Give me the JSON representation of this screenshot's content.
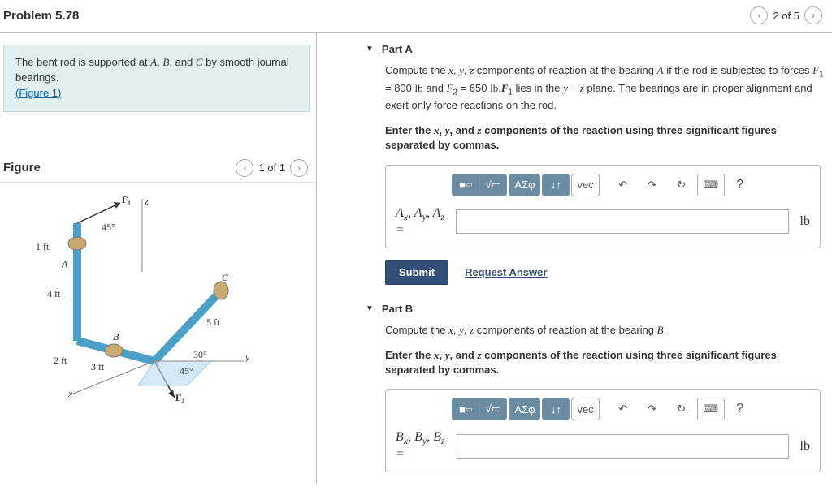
{
  "header": {
    "title": "Problem 5.78",
    "pager": "2 of 5"
  },
  "problem": {
    "line1_pre": "The bent rod is supported at ",
    "A": "A",
    "B": "B",
    "C": "C",
    "line1_mid1": ", ",
    "line1_mid2": ", and ",
    "line1_post": " by smooth journal bearings.",
    "fig_link": "(Figure 1)"
  },
  "figure": {
    "heading": "Figure",
    "pager": "1 of 1",
    "labels": {
      "F1": "F₁",
      "F2": "F₂",
      "A": "A",
      "B": "B",
      "C": "C",
      "z": "z",
      "y": "y",
      "x": "x",
      "ang45": "45°",
      "ang30": "30°",
      "ang45b": "45°",
      "d1ft": "1 ft",
      "d4ft": "4 ft",
      "d2ft": "2 ft",
      "d3ft": "3 ft",
      "d5ft": "5 ft"
    }
  },
  "partA": {
    "title": "Part A",
    "prompt_html": "Compute the <span class='serif-i'>x</span>, <span class='serif-i'>y</span>, <span class='serif-i'>z</span> components of reaction at the bearing <span class='serif-i'>A</span> if the rod is subjected to forces <span class='serif-i'>F</span><sub>1</sub> = 800 <span class='serif'>lb</span> and <span class='serif-i'>F</span><sub>2</sub> = 650 <span class='serif'>lb</span>.<span class='serif-i'><b>F</b></span><sub>1</sub> lies in the <span class='serif-i'>y</span> − <span class='serif-i'>z</span> plane. The bearings are in proper alignment and exert only force reactions on the rod.",
    "instr_html": "Enter the <span class='serif-i'>x</span>, <span class='serif-i'>y</span>, and <span class='serif-i'>z</span> components of the reaction using three significant figures separated by commas.",
    "var_html": "<span class='serif-i'>A<sub>x</sub></span>, <span class='serif-i'>A<sub>y</sub></span>, <span class='serif-i'>A<sub>z</sub></span><br>=",
    "unit": "lb",
    "submit": "Submit",
    "request": "Request Answer"
  },
  "partB": {
    "title": "Part B",
    "prompt_html": "Compute the <span class='serif-i'>x</span>, <span class='serif-i'>y</span>, <span class='serif-i'>z</span> components of reaction at the bearing <span class='serif-i'>B</span>.",
    "instr_html": "Enter the <span class='serif-i'>x</span>, <span class='serif-i'>y</span>, and <span class='serif-i'>z</span> components of the reaction using three significant figures separated by commas.",
    "var_html": "<span class='serif-i'>B<sub>x</sub></span>, <span class='serif-i'>B<sub>y</sub></span>, <span class='serif-i'>B<sub>z</sub></span><br>=",
    "unit": "lb"
  },
  "toolbar": {
    "template": "▭",
    "fraction": "√▭",
    "greek": "ΑΣφ",
    "arrows": "↓↑",
    "vec": "vec",
    "undo": "↶",
    "redo": "↷",
    "reset": "↻",
    "keyboard": "⌨",
    "help": "?"
  }
}
